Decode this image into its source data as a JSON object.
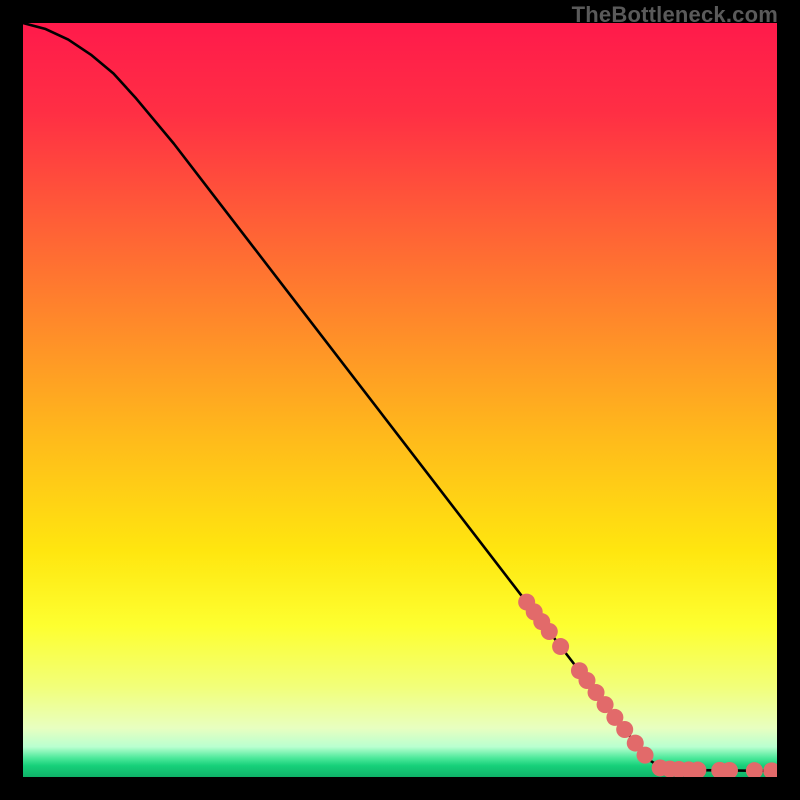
{
  "watermark": "TheBottleneck.com",
  "chart_data": {
    "type": "line",
    "title": "",
    "xlabel": "",
    "ylabel": "",
    "xlim": [
      0,
      100
    ],
    "ylim": [
      0,
      100
    ],
    "grid": false,
    "background_gradient": {
      "stops": [
        {
          "offset": 0.0,
          "color": "#ff1a4b"
        },
        {
          "offset": 0.12,
          "color": "#ff2f44"
        },
        {
          "offset": 0.25,
          "color": "#ff5a38"
        },
        {
          "offset": 0.4,
          "color": "#ff8a2a"
        },
        {
          "offset": 0.55,
          "color": "#ffba1b"
        },
        {
          "offset": 0.7,
          "color": "#ffe60f"
        },
        {
          "offset": 0.8,
          "color": "#fdff30"
        },
        {
          "offset": 0.88,
          "color": "#f2ff79"
        },
        {
          "offset": 0.935,
          "color": "#e8ffc0"
        },
        {
          "offset": 0.96,
          "color": "#b9ffd0"
        },
        {
          "offset": 0.975,
          "color": "#4be89a"
        },
        {
          "offset": 0.985,
          "color": "#16d07a"
        },
        {
          "offset": 1.0,
          "color": "#0fb268"
        }
      ]
    },
    "series": [
      {
        "name": "curve",
        "stroke": "#000000",
        "stroke_width": 2.6,
        "points": [
          {
            "x": 0.0,
            "y": 100.0
          },
          {
            "x": 3.0,
            "y": 99.2
          },
          {
            "x": 6.0,
            "y": 97.8
          },
          {
            "x": 9.0,
            "y": 95.8
          },
          {
            "x": 12.0,
            "y": 93.3
          },
          {
            "x": 15.0,
            "y": 90.0
          },
          {
            "x": 20.0,
            "y": 84.0
          },
          {
            "x": 25.0,
            "y": 77.5
          },
          {
            "x": 30.0,
            "y": 71.0
          },
          {
            "x": 35.0,
            "y": 64.5
          },
          {
            "x": 40.0,
            "y": 58.0
          },
          {
            "x": 45.0,
            "y": 51.5
          },
          {
            "x": 50.0,
            "y": 45.0
          },
          {
            "x": 55.0,
            "y": 38.5
          },
          {
            "x": 60.0,
            "y": 32.0
          },
          {
            "x": 65.0,
            "y": 25.5
          },
          {
            "x": 70.0,
            "y": 19.0
          },
          {
            "x": 75.0,
            "y": 12.5
          },
          {
            "x": 80.0,
            "y": 6.0
          },
          {
            "x": 83.0,
            "y": 2.3
          },
          {
            "x": 85.0,
            "y": 1.0
          },
          {
            "x": 90.0,
            "y": 0.9
          },
          {
            "x": 95.0,
            "y": 0.85
          },
          {
            "x": 100.0,
            "y": 0.8
          }
        ]
      }
    ],
    "markers": {
      "name": "highlight-dots",
      "color": "#e26a6a",
      "radius": 8.5,
      "points": [
        {
          "x": 66.8,
          "y": 23.2
        },
        {
          "x": 67.8,
          "y": 21.9
        },
        {
          "x": 68.8,
          "y": 20.6
        },
        {
          "x": 69.8,
          "y": 19.3
        },
        {
          "x": 71.3,
          "y": 17.3
        },
        {
          "x": 73.8,
          "y": 14.1
        },
        {
          "x": 74.8,
          "y": 12.8
        },
        {
          "x": 76.0,
          "y": 11.2
        },
        {
          "x": 77.2,
          "y": 9.6
        },
        {
          "x": 78.5,
          "y": 7.9
        },
        {
          "x": 79.8,
          "y": 6.3
        },
        {
          "x": 81.2,
          "y": 4.5
        },
        {
          "x": 82.5,
          "y": 2.9
        },
        {
          "x": 84.5,
          "y": 1.2
        },
        {
          "x": 85.8,
          "y": 1.05
        },
        {
          "x": 87.0,
          "y": 1.0
        },
        {
          "x": 88.3,
          "y": 0.95
        },
        {
          "x": 89.5,
          "y": 0.92
        },
        {
          "x": 92.4,
          "y": 0.88
        },
        {
          "x": 93.7,
          "y": 0.87
        },
        {
          "x": 97.0,
          "y": 0.84
        },
        {
          "x": 99.3,
          "y": 0.82
        }
      ]
    }
  }
}
